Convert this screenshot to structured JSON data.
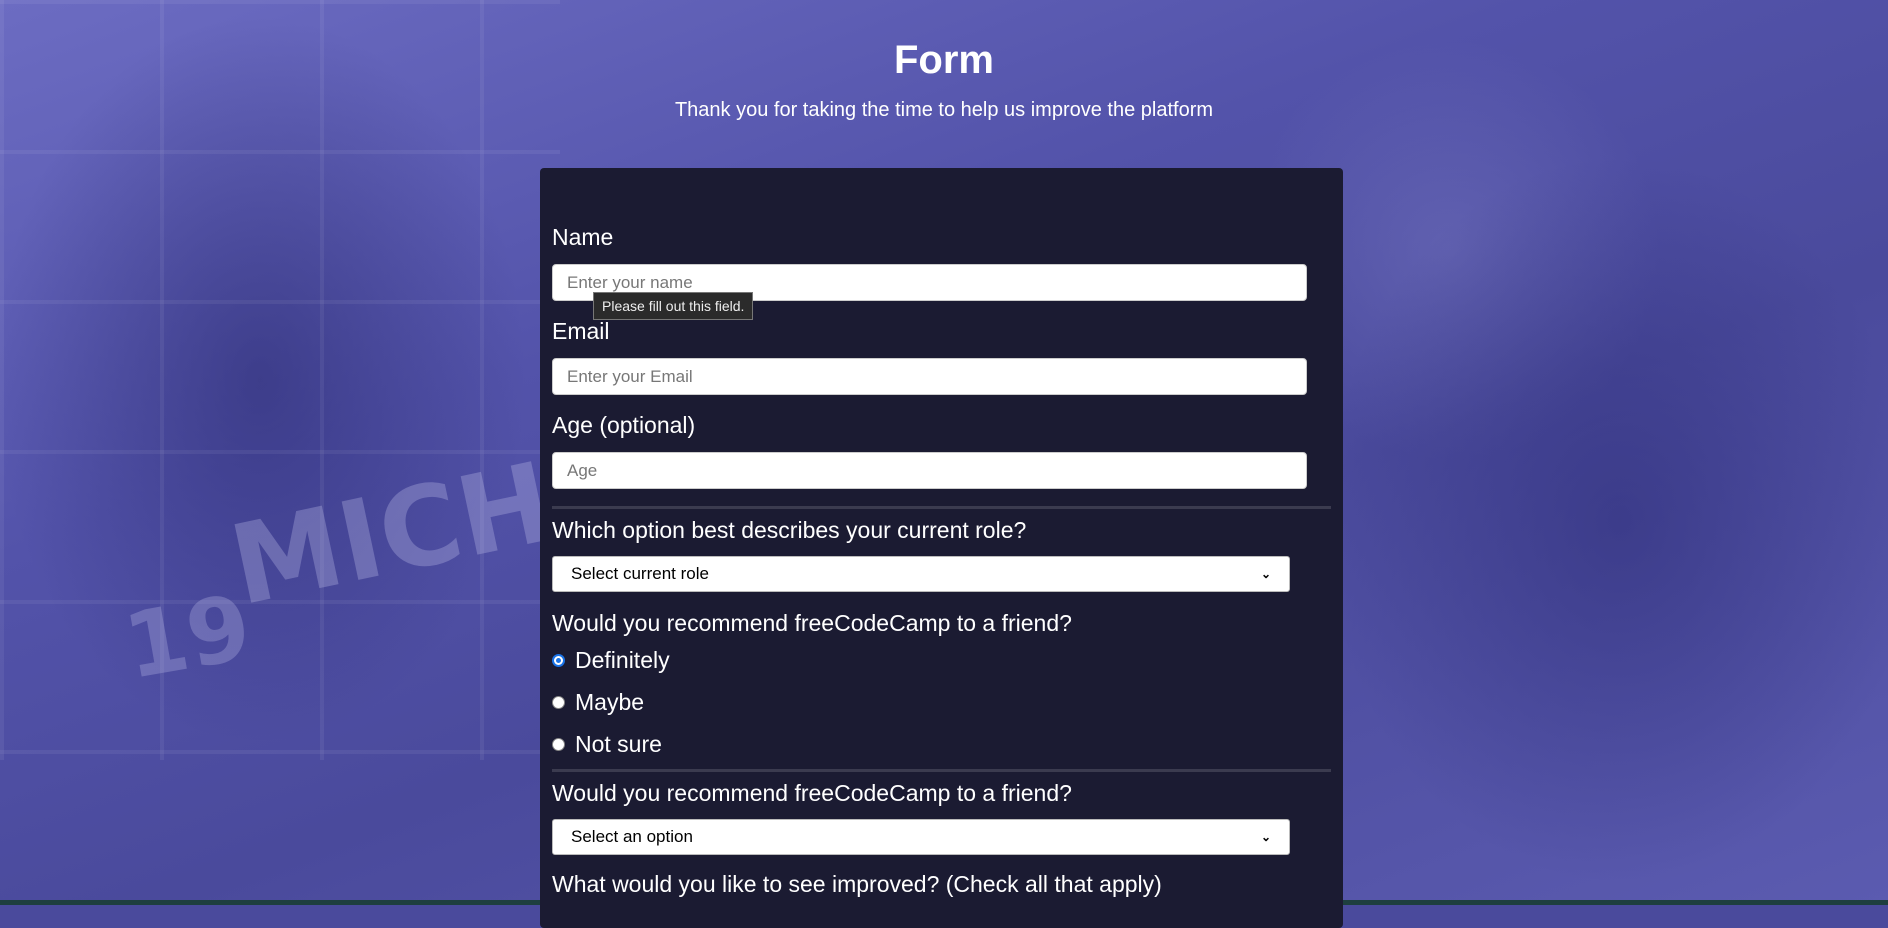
{
  "header": {
    "title": "Form",
    "subtitle": "Thank you for taking the time to help us improve the platform"
  },
  "form": {
    "name": {
      "label": "Name",
      "placeholder": "Enter your name"
    },
    "email": {
      "label": "Email",
      "placeholder": "Enter your Email"
    },
    "age": {
      "label": "Age (optional)",
      "placeholder": "Age"
    },
    "role": {
      "question": "Which option best describes your current role?",
      "selected": "Select current role"
    },
    "recommend": {
      "question": "Would you recommend freeCodeCamp to a friend?",
      "options": [
        "Definitely",
        "Maybe",
        "Not sure"
      ],
      "checked_index": 0
    },
    "recommend_select": {
      "question": "Would you recommend freeCodeCamp to a friend?",
      "selected": "Select an option"
    },
    "improve": {
      "question": "What would you like to see improved? (Check all that apply)"
    }
  },
  "tooltip": {
    "text": "Please fill out this field."
  },
  "background_text": {
    "shirt_letters": "MICH",
    "shirt_number": "19"
  },
  "colors": {
    "card": "#1b1b32",
    "background": "#4a4a9c",
    "radio_accent": "#1a73e8"
  }
}
